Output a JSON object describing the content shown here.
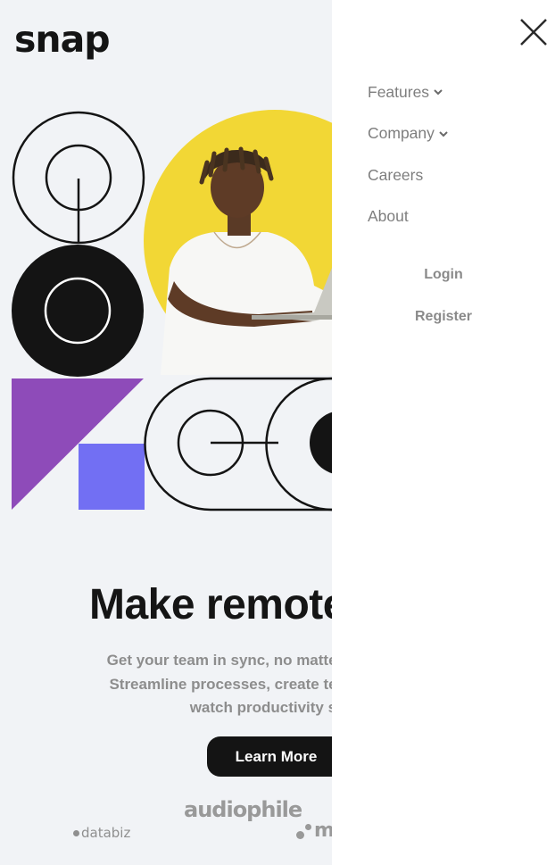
{
  "header": {
    "logo": "snap"
  },
  "hero": {
    "headline": "Make remote work",
    "subtext_lines": [
      "Get your team in sync, no matter your location.",
      "Streamline processes, create team rituals, and",
      "watch productivity soar."
    ],
    "cta_label": "Learn More",
    "accent_colors": {
      "yellow": "#f2d735",
      "purple": "#8e4bb9",
      "blue": "#726ff3",
      "ink": "#141414"
    }
  },
  "clients": [
    {
      "name": "databiz"
    },
    {
      "name": "audiophile"
    },
    {
      "name": "meet"
    }
  ],
  "menu": {
    "close_icon": "close-icon",
    "items": [
      {
        "label": "Features",
        "has_dropdown": true
      },
      {
        "label": "Company",
        "has_dropdown": true
      },
      {
        "label": "Careers",
        "has_dropdown": false
      },
      {
        "label": "About",
        "has_dropdown": false
      }
    ],
    "login_label": "Login",
    "register_label": "Register"
  }
}
